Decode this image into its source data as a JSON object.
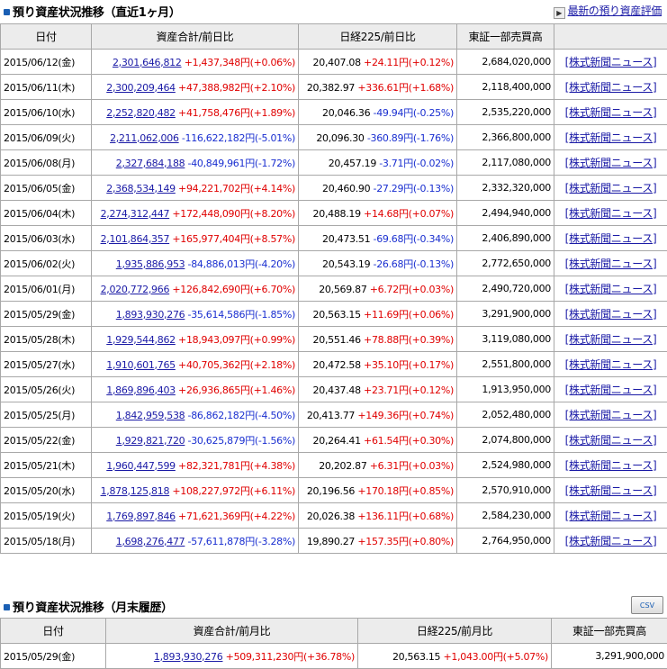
{
  "section1": {
    "title": "預り資産状況推移（直近1ヶ月）",
    "link_label": "最新の預り資産評価",
    "headers": [
      "日付",
      "資産合計/前日比",
      "日経225/前日比",
      "東証一部売買高",
      ""
    ],
    "rows": [
      {
        "date": "2015/06/12(金)",
        "assets": "2,301,646,812",
        "asset_change": "+1,437,348円(+0.06%)",
        "asset_dir": "up",
        "nikkei": "20,407.08",
        "nikkei_change": "+24.11円(+0.12%)",
        "nikkei_dir": "up",
        "volume": "2,684,020,000",
        "news": "[株式新聞ニュース]"
      },
      {
        "date": "2015/06/11(木)",
        "assets": "2,300,209,464",
        "asset_change": "+47,388,982円(+2.10%)",
        "asset_dir": "up",
        "nikkei": "20,382.97",
        "nikkei_change": "+336.61円(+1.68%)",
        "nikkei_dir": "up",
        "volume": "2,118,400,000",
        "news": "[株式新聞ニュース]"
      },
      {
        "date": "2015/06/10(水)",
        "assets": "2,252,820,482",
        "asset_change": "+41,758,476円(+1.89%)",
        "asset_dir": "up",
        "nikkei": "20,046.36",
        "nikkei_change": "-49.94円(-0.25%)",
        "nikkei_dir": "dn",
        "volume": "2,535,220,000",
        "news": "[株式新聞ニュース]"
      },
      {
        "date": "2015/06/09(火)",
        "assets": "2,211,062,006",
        "asset_change": "-116,622,182円(-5.01%)",
        "asset_dir": "dn",
        "nikkei": "20,096.30",
        "nikkei_change": "-360.89円(-1.76%)",
        "nikkei_dir": "dn",
        "volume": "2,366,800,000",
        "news": "[株式新聞ニュース]"
      },
      {
        "date": "2015/06/08(月)",
        "assets": "2,327,684,188",
        "asset_change": "-40,849,961円(-1.72%)",
        "asset_dir": "dn",
        "nikkei": "20,457.19",
        "nikkei_change": "-3.71円(-0.02%)",
        "nikkei_dir": "dn",
        "volume": "2,117,080,000",
        "news": "[株式新聞ニュース]"
      },
      {
        "date": "2015/06/05(金)",
        "assets": "2,368,534,149",
        "asset_change": "+94,221,702円(+4.14%)",
        "asset_dir": "up",
        "nikkei": "20,460.90",
        "nikkei_change": "-27.29円(-0.13%)",
        "nikkei_dir": "dn",
        "volume": "2,332,320,000",
        "news": "[株式新聞ニュース]"
      },
      {
        "date": "2015/06/04(木)",
        "assets": "2,274,312,447",
        "asset_change": "+172,448,090円(+8.20%)",
        "asset_dir": "up",
        "nikkei": "20,488.19",
        "nikkei_change": "+14.68円(+0.07%)",
        "nikkei_dir": "up",
        "volume": "2,494,940,000",
        "news": "[株式新聞ニュース]"
      },
      {
        "date": "2015/06/03(水)",
        "assets": "2,101,864,357",
        "asset_change": "+165,977,404円(+8.57%)",
        "asset_dir": "up",
        "nikkei": "20,473.51",
        "nikkei_change": "-69.68円(-0.34%)",
        "nikkei_dir": "dn",
        "volume": "2,406,890,000",
        "news": "[株式新聞ニュース]"
      },
      {
        "date": "2015/06/02(火)",
        "assets": "1,935,886,953",
        "asset_change": "-84,886,013円(-4.20%)",
        "asset_dir": "dn",
        "nikkei": "20,543.19",
        "nikkei_change": "-26.68円(-0.13%)",
        "nikkei_dir": "dn",
        "volume": "2,772,650,000",
        "news": "[株式新聞ニュース]"
      },
      {
        "date": "2015/06/01(月)",
        "assets": "2,020,772,966",
        "asset_change": "+126,842,690円(+6.70%)",
        "asset_dir": "up",
        "nikkei": "20,569.87",
        "nikkei_change": "+6.72円(+0.03%)",
        "nikkei_dir": "up",
        "volume": "2,490,720,000",
        "news": "[株式新聞ニュース]"
      },
      {
        "date": "2015/05/29(金)",
        "assets": "1,893,930,276",
        "asset_change": "-35,614,586円(-1.85%)",
        "asset_dir": "dn",
        "nikkei": "20,563.15",
        "nikkei_change": "+11.69円(+0.06%)",
        "nikkei_dir": "up",
        "volume": "3,291,900,000",
        "news": "[株式新聞ニュース]"
      },
      {
        "date": "2015/05/28(木)",
        "assets": "1,929,544,862",
        "asset_change": "+18,943,097円(+0.99%)",
        "asset_dir": "up",
        "nikkei": "20,551.46",
        "nikkei_change": "+78.88円(+0.39%)",
        "nikkei_dir": "up",
        "volume": "3,119,080,000",
        "news": "[株式新聞ニュース]"
      },
      {
        "date": "2015/05/27(水)",
        "assets": "1,910,601,765",
        "asset_change": "+40,705,362円(+2.18%)",
        "asset_dir": "up",
        "nikkei": "20,472.58",
        "nikkei_change": "+35.10円(+0.17%)",
        "nikkei_dir": "up",
        "volume": "2,551,800,000",
        "news": "[株式新聞ニュース]"
      },
      {
        "date": "2015/05/26(火)",
        "assets": "1,869,896,403",
        "asset_change": "+26,936,865円(+1.46%)",
        "asset_dir": "up",
        "nikkei": "20,437.48",
        "nikkei_change": "+23.71円(+0.12%)",
        "nikkei_dir": "up",
        "volume": "1,913,950,000",
        "news": "[株式新聞ニュース]"
      },
      {
        "date": "2015/05/25(月)",
        "assets": "1,842,959,538",
        "asset_change": "-86,862,182円(-4.50%)",
        "asset_dir": "dn",
        "nikkei": "20,413.77",
        "nikkei_change": "+149.36円(+0.74%)",
        "nikkei_dir": "up",
        "volume": "2,052,480,000",
        "news": "[株式新聞ニュース]"
      },
      {
        "date": "2015/05/22(金)",
        "assets": "1,929,821,720",
        "asset_change": "-30,625,879円(-1.56%)",
        "asset_dir": "dn",
        "nikkei": "20,264.41",
        "nikkei_change": "+61.54円(+0.30%)",
        "nikkei_dir": "up",
        "volume": "2,074,800,000",
        "news": "[株式新聞ニュース]"
      },
      {
        "date": "2015/05/21(木)",
        "assets": "1,960,447,599",
        "asset_change": "+82,321,781円(+4.38%)",
        "asset_dir": "up",
        "nikkei": "20,202.87",
        "nikkei_change": "+6.31円(+0.03%)",
        "nikkei_dir": "up",
        "volume": "2,524,980,000",
        "news": "[株式新聞ニュース]"
      },
      {
        "date": "2015/05/20(水)",
        "assets": "1,878,125,818",
        "asset_change": "+108,227,972円(+6.11%)",
        "asset_dir": "up",
        "nikkei": "20,196.56",
        "nikkei_change": "+170.18円(+0.85%)",
        "nikkei_dir": "up",
        "volume": "2,570,910,000",
        "news": "[株式新聞ニュース]"
      },
      {
        "date": "2015/05/19(火)",
        "assets": "1,769,897,846",
        "asset_change": "+71,621,369円(+4.22%)",
        "asset_dir": "up",
        "nikkei": "20,026.38",
        "nikkei_change": "+136.11円(+0.68%)",
        "nikkei_dir": "up",
        "volume": "2,584,230,000",
        "news": "[株式新聞ニュース]"
      },
      {
        "date": "2015/05/18(月)",
        "assets": "1,698,276,477",
        "asset_change": "-57,611,878円(-3.28%)",
        "asset_dir": "dn",
        "nikkei": "19,890.27",
        "nikkei_change": "+157.35円(+0.80%)",
        "nikkei_dir": "up",
        "volume": "2,764,950,000",
        "news": "[株式新聞ニュース]"
      }
    ]
  },
  "section2": {
    "title": "預り資産状況推移（月末履歴）",
    "csv_label": "CSV",
    "headers": [
      "日付",
      "資産合計/前月比",
      "日経225/前月比",
      "東証一部売買高"
    ],
    "rows": [
      {
        "date": "2015/05/29(金)",
        "assets": "1,893,930,276",
        "asset_change": "+509,311,230円(+36.78%)",
        "asset_dir": "up",
        "nikkei": "20,563.15",
        "nikkei_change": "+1,043.00円(+5.07%)",
        "nikkei_dir": "up",
        "volume": "3,291,900,000"
      }
    ]
  },
  "colors": {
    "up": "#e00000",
    "down": "#1a2fd0",
    "link": "#1a1aa6",
    "header_bg": "#ececec",
    "bullet": "#1a5fb4"
  }
}
